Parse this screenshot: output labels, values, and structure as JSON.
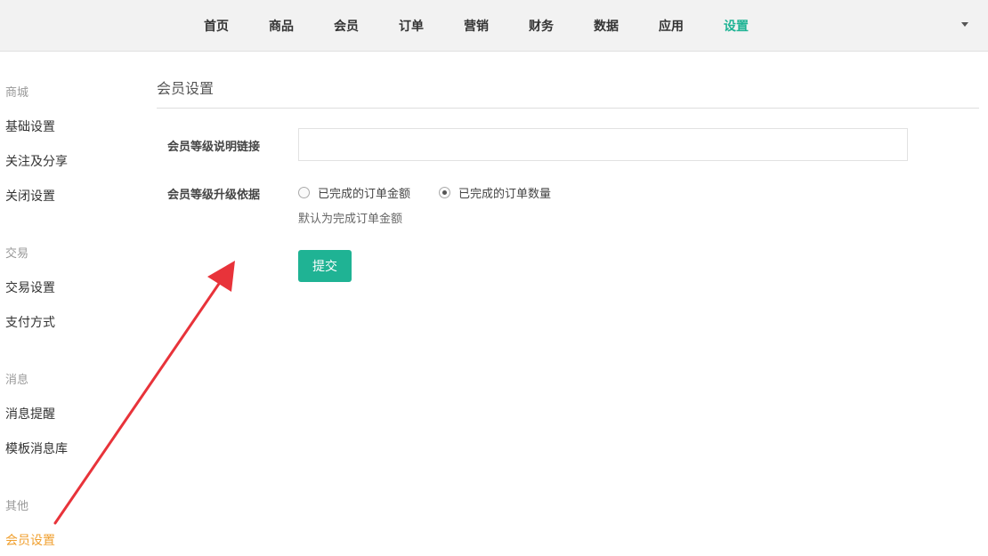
{
  "top_nav": {
    "items": [
      {
        "label": "首页"
      },
      {
        "label": "商品"
      },
      {
        "label": "会员"
      },
      {
        "label": "订单"
      },
      {
        "label": "营销"
      },
      {
        "label": "财务"
      },
      {
        "label": "数据"
      },
      {
        "label": "应用"
      },
      {
        "label": "设置"
      }
    ],
    "active_index": 8
  },
  "sidebar": {
    "groups": [
      {
        "title": "商城",
        "items": [
          "基础设置",
          "关注及分享",
          "关闭设置"
        ]
      },
      {
        "title": "交易",
        "items": [
          "交易设置",
          "支付方式"
        ]
      },
      {
        "title": "消息",
        "items": [
          "消息提醒",
          "模板消息库"
        ]
      },
      {
        "title": "其他",
        "items": [
          "会员设置"
        ]
      }
    ],
    "active_item": "会员设置"
  },
  "main": {
    "title": "会员设置",
    "form": {
      "link_label": "会员等级说明链接",
      "link_value": "",
      "upgrade_label": "会员等级升级依据",
      "options": [
        {
          "label": "已完成的订单金额",
          "checked": false
        },
        {
          "label": "已完成的订单数量",
          "checked": true
        }
      ],
      "help_text": "默认为完成订单金额",
      "submit_label": "提交"
    }
  },
  "colors": {
    "accent": "#1fb394",
    "sidebar_active": "#f0a030",
    "annotation_arrow": "#e8333a"
  },
  "icons": {
    "nav_dropdown": "chevron-down-icon",
    "annotation": "red-arrow-annotation"
  }
}
